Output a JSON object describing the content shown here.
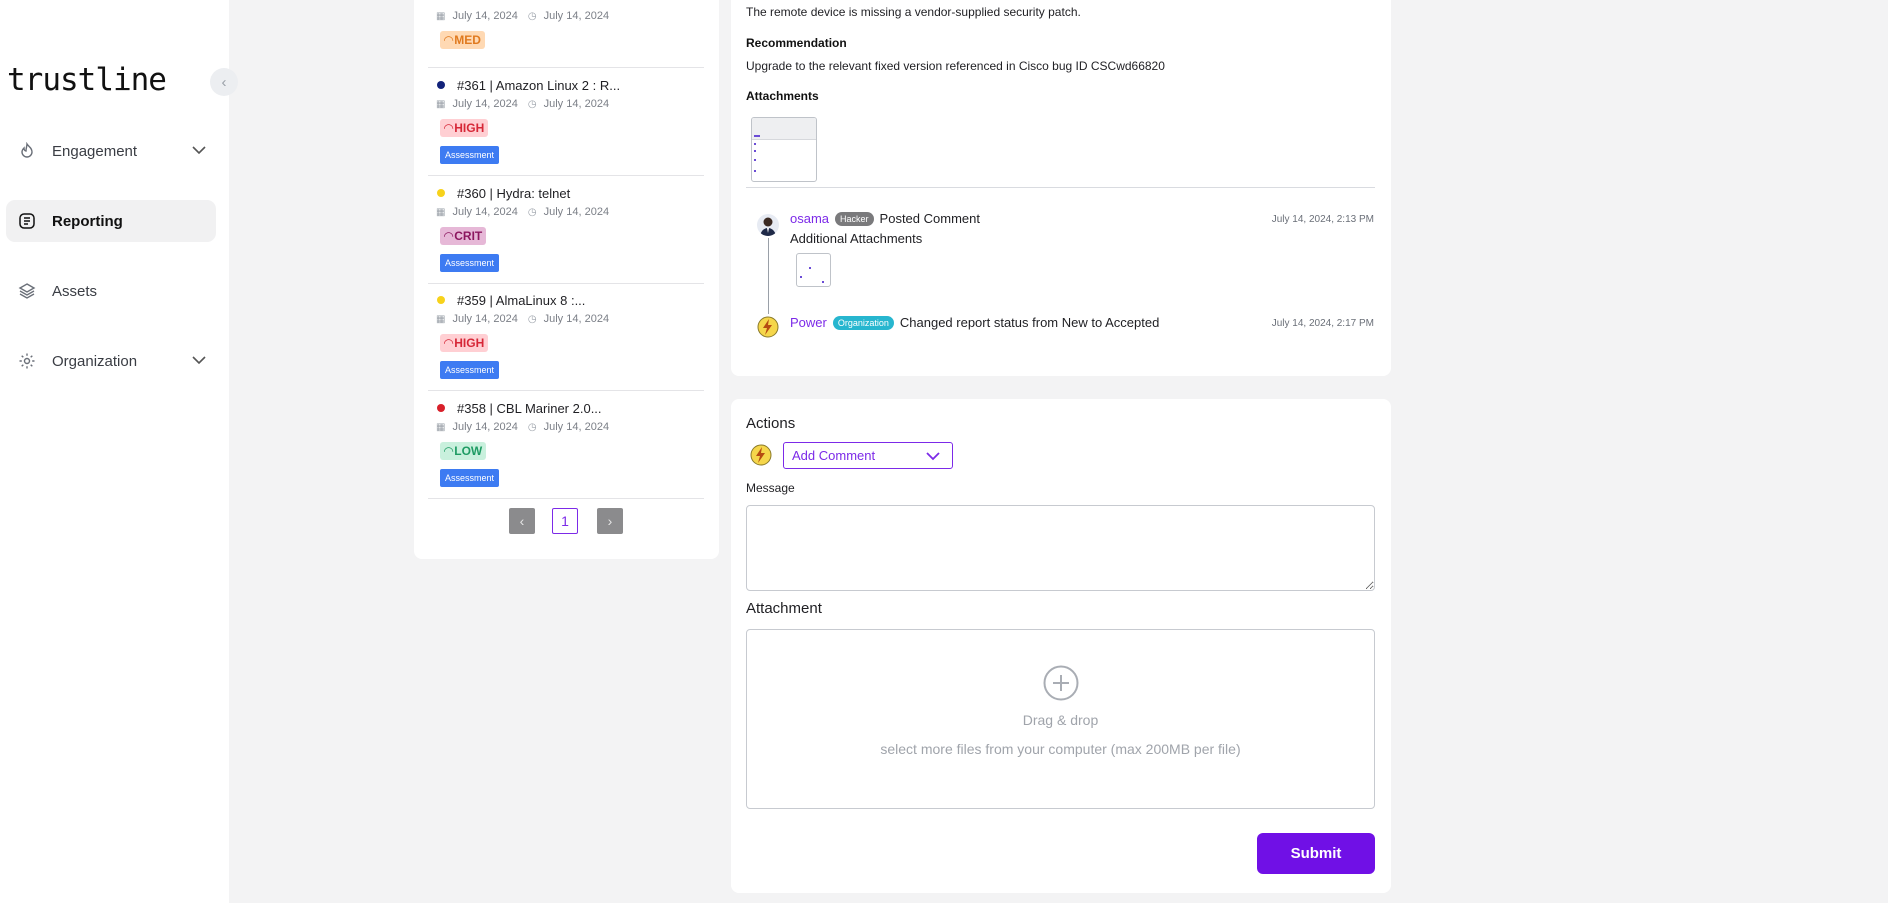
{
  "sidebar": {
    "logo": "trustline",
    "items": [
      {
        "label": "Engagement"
      },
      {
        "label": "Reporting"
      },
      {
        "label": "Assets"
      },
      {
        "label": "Organization"
      }
    ]
  },
  "reports": [
    {
      "title": "",
      "date_created": "July 14, 2024",
      "date_updated": "July 14, 2024",
      "severity": "MED",
      "dot": "#f0c419",
      "assessment": ""
    },
    {
      "title": "#361 | Amazon Linux 2 : R...",
      "date_created": "July 14, 2024",
      "date_updated": "July 14, 2024",
      "severity": "HIGH",
      "dot": "#12237a",
      "assessment": "Assessment"
    },
    {
      "title": "#360 | Hydra: telnet",
      "date_created": "July 14, 2024",
      "date_updated": "July 14, 2024",
      "severity": "CRIT",
      "dot": "#f7d21b",
      "assessment": "Assessment"
    },
    {
      "title": "#359 | AlmaLinux 8 :...",
      "date_created": "July 14, 2024",
      "date_updated": "July 14, 2024",
      "severity": "HIGH",
      "dot": "#f7d21b",
      "assessment": "Assessment"
    },
    {
      "title": "#358 | CBL Mariner 2.0...",
      "date_created": "July 14, 2024",
      "date_updated": "July 14, 2024",
      "severity": "LOW",
      "dot": "#d8202a",
      "assessment": "Assessment"
    }
  ],
  "pagination": {
    "prev": "‹",
    "current": "1",
    "next": "›"
  },
  "detail": {
    "description": "The remote device is missing a vendor-supplied security patch.",
    "recommendation_header": "Recommendation",
    "recommendation": "Upgrade to the relevant fixed version referenced in Cisco bug ID CSCwd66820",
    "attachments_header": "Attachments"
  },
  "activity": [
    {
      "user": "osama",
      "role": "Hacker",
      "action": "Posted Comment",
      "timestamp": "July 14, 2024, 2:13 PM",
      "body": "Additional Attachments"
    },
    {
      "user": "Power",
      "role": "Organization",
      "action": "Changed report status from New to Accepted",
      "timestamp": "July 14, 2024, 2:17 PM"
    }
  ],
  "actions": {
    "title": "Actions",
    "select_value": "Add Comment",
    "message_label": "Message",
    "attachment_label": "Attachment",
    "drop_title": "Drag & drop",
    "drop_hint": "select more files from your computer (max 200MB per file)",
    "submit": "Submit"
  },
  "colors": {
    "accent": "#7010e6",
    "assessment": "#3d7bf2",
    "organization": "#27b6cf"
  }
}
